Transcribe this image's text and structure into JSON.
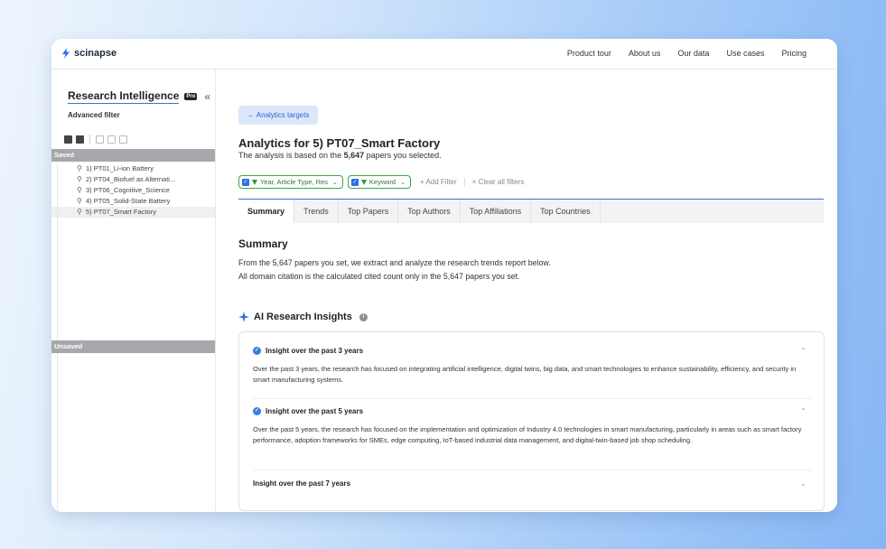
{
  "brand": {
    "name": "scinapse"
  },
  "nav": [
    "Product tour",
    "About us",
    "Our data",
    "Use cases",
    "Pricing"
  ],
  "sidebar": {
    "title": "Research Intelligence",
    "badge": "Pro",
    "collapse": "«",
    "subtitle": "Advanced filter",
    "saved_header": "Saved",
    "unsaved_header": "Unsaved",
    "saved_items": [
      "1) PT01_Li-ion Battery",
      "2) PT04_Biofuel as Alternati...",
      "3) PT06_Cognitive_Science",
      "4) PT05_Solid-State Battery",
      "5) PT07_Smart Factory"
    ]
  },
  "main": {
    "back_label": "← Analytics targets",
    "title": "Analytics for 5) PT07_Smart Factory",
    "desc_prefix": "The analysis is based on the ",
    "desc_count": "5,647",
    "desc_suffix": " papers you selected.",
    "filters": [
      {
        "label": "Year, Article Type, Res"
      },
      {
        "label": "Keyword"
      }
    ],
    "add_filter": "+ Add Filter",
    "clear_filters": "× Clear all filters",
    "tabs": [
      "Summary",
      "Trends",
      "Top Papers",
      "Top Authors",
      "Top Affiliations",
      "Top Countries"
    ],
    "summary_title": "Summary",
    "summary_line1": "From the 5,647 papers you set, we extract and analyze the research trends report below.",
    "summary_line2": "All domain citation is the calculated cited count only in the 5,647 papers you set.",
    "ai_title": "AI Research Insights",
    "insights": [
      {
        "title": "Insight over the past 3 years",
        "body": "Over the past 3 years, the research has focused on integrating artificial intelligence, digital twins, big data, and smart technologies to enhance sustainability, efficiency, and security in smart manufacturing systems."
      },
      {
        "title": "Insight over the past 5 years",
        "body": "Over the past 5 years, the research has focused on the implementation and optimization of Industry 4.0 technologies in smart manufacturing, particularly in areas such as smart factory performance, adoption frameworks for SMEs, edge computing, IoT-based industrial data management, and digital-twin-based job shop scheduling."
      },
      {
        "title": "Insight over the past 7 years",
        "body": ""
      }
    ]
  },
  "colors": {
    "accent": "#3b6fd8",
    "filter_green": "#3aa548",
    "section_gray": "#a6a8ab"
  }
}
